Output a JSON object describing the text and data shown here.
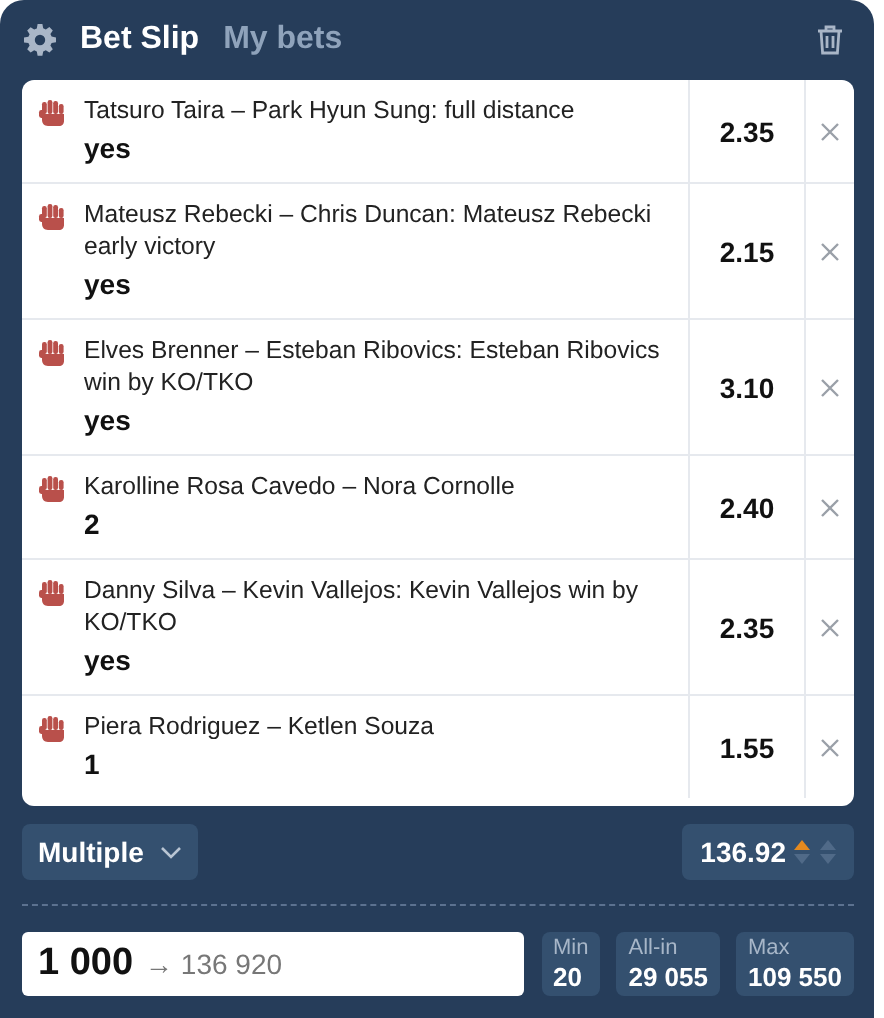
{
  "header": {
    "tabs": [
      {
        "label": "Bet Slip",
        "selected": true
      },
      {
        "label": "My bets",
        "selected": false
      }
    ]
  },
  "bets": [
    {
      "event": "Tatsuro Taira – Park Hyun Sung: full distance",
      "selection": "yes",
      "odds": "2.35"
    },
    {
      "event": "Mateusz Rebecki – Chris Duncan: Mateusz Rebecki early victory",
      "selection": "yes",
      "odds": "2.15"
    },
    {
      "event": "Elves Brenner – Esteban Ribovics: Esteban Ribovics win by KO/TKO",
      "selection": "yes",
      "odds": "3.10"
    },
    {
      "event": "Karolline Rosa Cavedo – Nora Cornolle",
      "selection": "2",
      "odds": "2.40"
    },
    {
      "event": "Danny Silva – Kevin Vallejos: Kevin Vallejos win by KO/TKO",
      "selection": "yes",
      "odds": "2.35"
    },
    {
      "event": "Piera Rodriguez – Ketlen Souza",
      "selection": "1",
      "odds": "1.55"
    }
  ],
  "bet_type": {
    "label": "Multiple"
  },
  "total_odds": {
    "value": "136.92"
  },
  "stake": {
    "value": "1 000",
    "payout": "→ 136 920"
  },
  "limits": [
    {
      "label": "Min",
      "value": "20"
    },
    {
      "label": "All-in",
      "value": "29 055"
    },
    {
      "label": "Max",
      "value": "109 550"
    }
  ]
}
